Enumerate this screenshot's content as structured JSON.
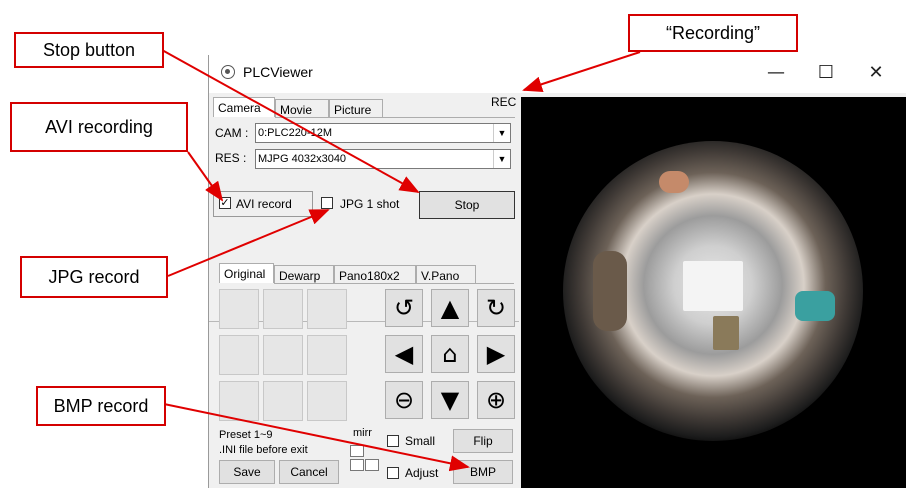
{
  "window": {
    "title": "PLCViewer",
    "minimize_glyph": "—",
    "maximize_glyph": "☐",
    "close_glyph": "✕",
    "rec_indicator": "REC"
  },
  "top_tabs": [
    "Camera",
    "Movie",
    "Picture"
  ],
  "camera": {
    "cam_label": "CAM :",
    "cam_value": "0:PLC220-12M",
    "res_label": "RES :",
    "res_value": "MJPG 4032x3040",
    "avi_label": "AVI record",
    "avi_checked": "✓",
    "jpg_label": "JPG 1 shot",
    "stop_label": "Stop"
  },
  "view_tabs": [
    "Original",
    "Dewarp",
    "Pano180x2",
    "V.Pano"
  ],
  "controls": {
    "rotate_ccw": "↺",
    "up": "▲",
    "rotate_cw": "↻",
    "left": "◀",
    "home": "⌂",
    "right": "▶",
    "zoom_out": "⊖",
    "down": "▼",
    "zoom_in": "⊕"
  },
  "bottom": {
    "preset_text": "Preset 1~9",
    "ini_text": ".INI file before exit",
    "mirr_label": "mirr",
    "small_label": "Small",
    "flip_label": "Flip",
    "adjust_label": "Adjust",
    "bmp_label": "BMP",
    "save_label": "Save",
    "cancel_label": "Cancel"
  },
  "callouts": {
    "stop_button": "Stop button",
    "recording": "“Recording”",
    "avi_recording": "AVI recording",
    "jpg_record": "JPG record",
    "bmp_record": "BMP record"
  },
  "colors": {
    "callout_red": "#e00000",
    "video_bg": "#000000"
  }
}
